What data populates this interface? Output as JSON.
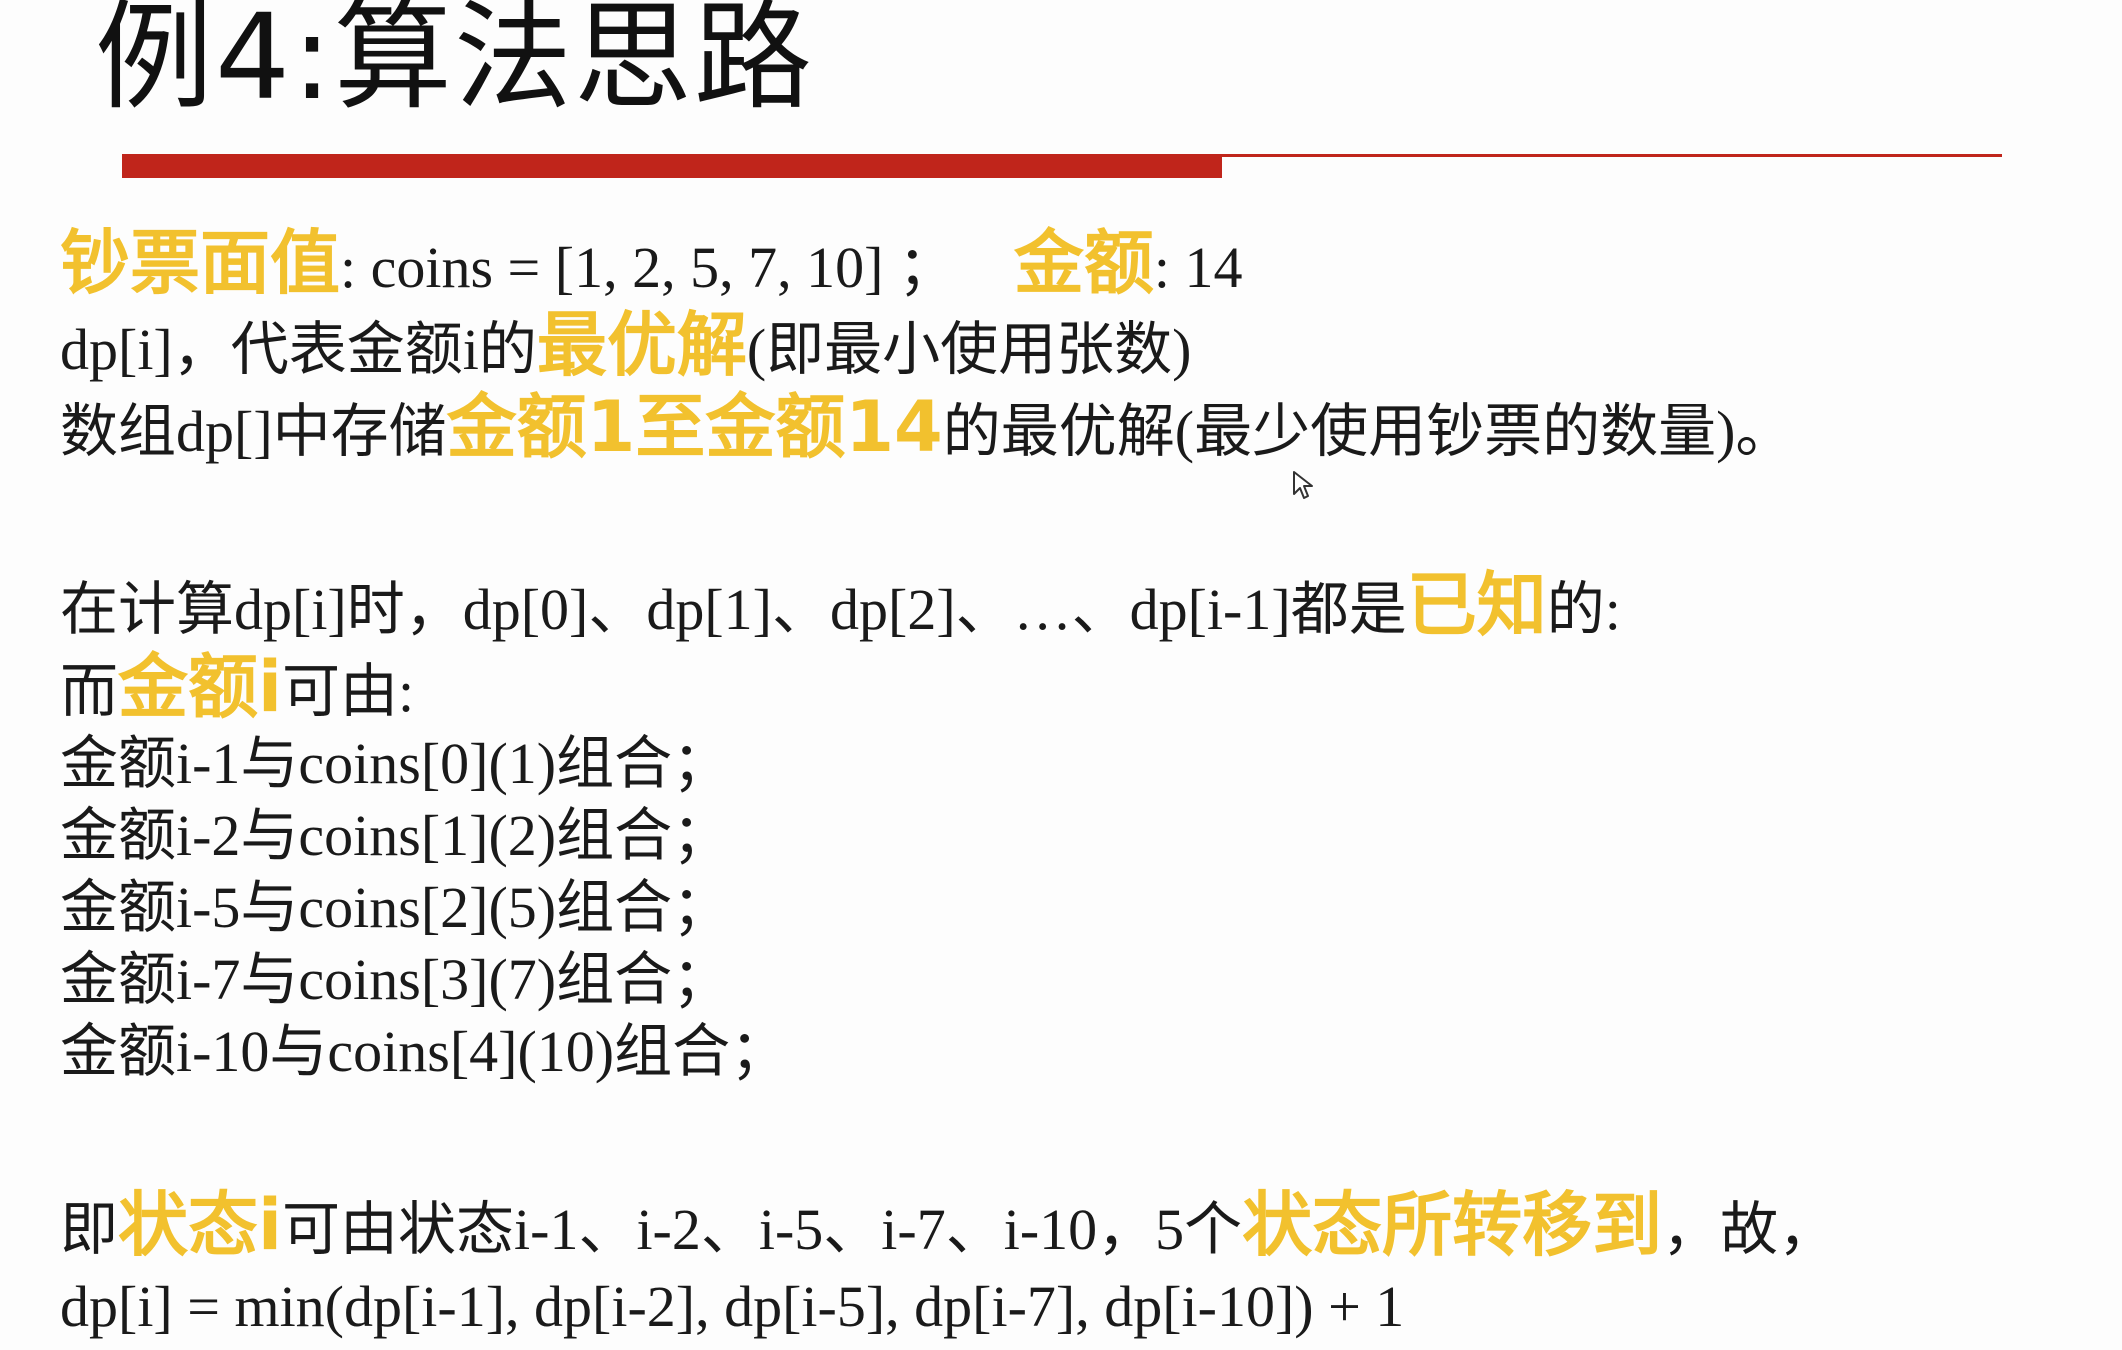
{
  "title": "例4:算法思路",
  "colors": {
    "accent_red": "#c0251b",
    "highlight_yellow": "#f2c12e",
    "text": "#1a1a1a"
  },
  "l1": {
    "hl1": "钞票面值",
    "t1": ": coins = [1, 2, 5, 7, 10] ；",
    "hl2": "金额",
    "t2": ": 14"
  },
  "l2": {
    "t1": "dp[i]，代表金额i的",
    "hl": "最优解",
    "t2": "(即最小使用张数)"
  },
  "l3": {
    "t1": "数组dp[]中存储",
    "hl": "金额1至金额14",
    "t2": "的最优解(最少使用钞票的数量)。"
  },
  "l4": {
    "t1": "在计算dp[i]时，dp[0]、dp[1]、dp[2]、…、dp[i-1]都是",
    "hl": "已知",
    "t2": "的:"
  },
  "l5": {
    "t1": "而",
    "hl": "金额i",
    "t2": "可由:"
  },
  "combos": [
    "金额i-1与coins[0](1)组合；",
    "金额i-2与coins[1](2)组合；",
    "金额i-5与coins[2](5)组合；",
    "金额i-7与coins[3](7)组合；",
    "金额i-10与coins[4](10)组合；"
  ],
  "l6": {
    "t1": "即",
    "hl1": "状态i",
    "t2": "可由状态i-1、i-2、i-5、i-7、i-10，5个",
    "hl2": "状态所转移到",
    "t3": "，故，"
  },
  "formula": "dp[i] = min(dp[i-1], dp[i-2], dp[i-5], dp[i-7], dp[i-10]) + 1",
  "cursor_icon": "mouse-pointer-icon"
}
